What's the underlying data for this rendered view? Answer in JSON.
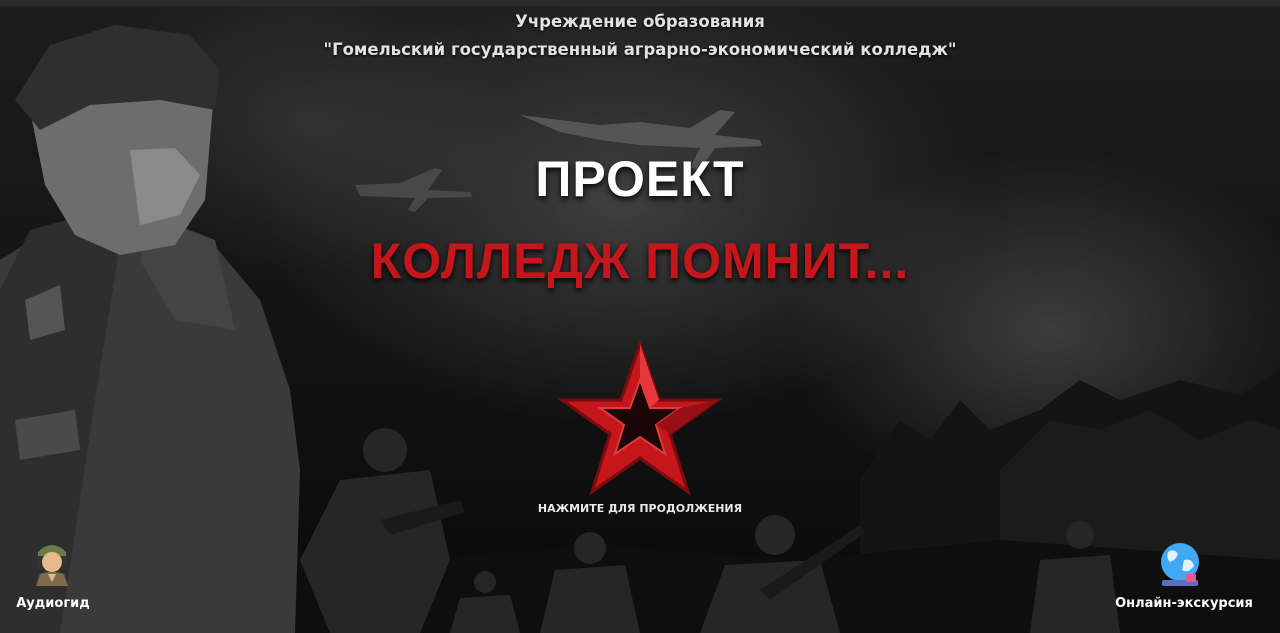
{
  "header": {
    "line1": "Учреждение образования",
    "line2": "\"Гомельский государственный аграрно-экономический колледж\""
  },
  "hero": {
    "title": "ПРОЕКТ",
    "subtitle": "КОЛЛЕДЖ ПОМНИТ...",
    "continue_label": "НАЖМИТЕ ДЛЯ ПРОДОЛЖЕНИЯ",
    "star_icon": "red-star-icon"
  },
  "bottom_left": {
    "label": "Аудиогид",
    "icon": "soldier-headphones-icon"
  },
  "bottom_right": {
    "label": "Онлайн-экскурсия",
    "icon": "globe-icon"
  },
  "colors": {
    "accent_red": "#c4161b",
    "text": "#ffffff",
    "background": "#0c0c0c"
  }
}
